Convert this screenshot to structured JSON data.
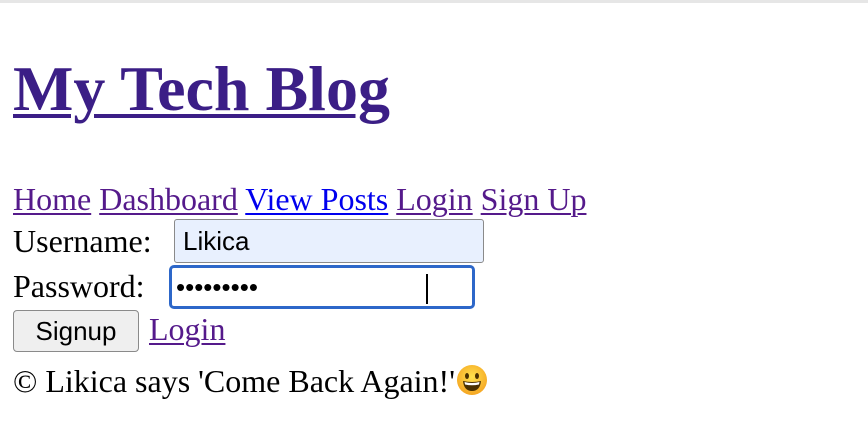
{
  "header": {
    "title": "My Tech Blog"
  },
  "nav": {
    "items": [
      {
        "label": "Home"
      },
      {
        "label": "Dashboard"
      },
      {
        "label": "View Posts"
      },
      {
        "label": "Login"
      },
      {
        "label": "Sign Up"
      }
    ]
  },
  "form": {
    "username_label": "Username:",
    "username_value": "Likica",
    "password_label": "Password:",
    "password_value": "•••••••••",
    "signup_label": "Signup",
    "login_link_label": "Login"
  },
  "footer": {
    "text": "© Likica says 'Come Back Again!'",
    "emoji": "grinning-face-icon"
  },
  "colors": {
    "visited_link": "#551a8b",
    "title_link": "#3b1e86",
    "unvisited_link": "#0000ee",
    "focus_border": "#2d67c9",
    "autofill_bg": "#e8f0fe"
  }
}
